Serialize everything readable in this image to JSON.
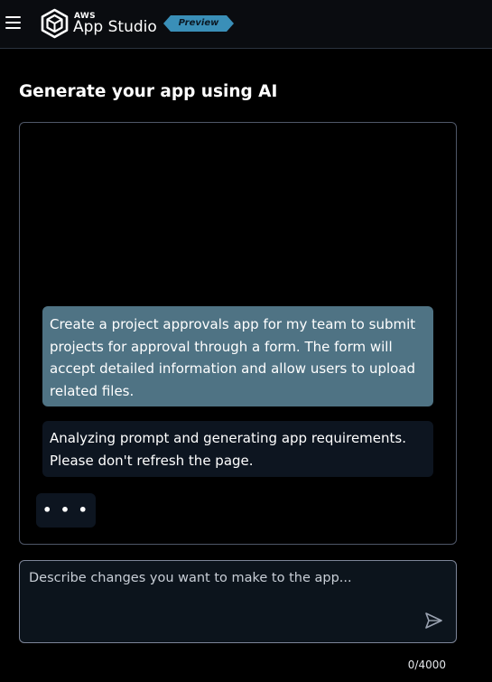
{
  "header": {
    "brand_small": "AWS",
    "brand_main": "App Studio",
    "badge": "Preview",
    "menu_icon": "hamburger-menu-icon",
    "logo_icon": "app-studio-cube-logo"
  },
  "page": {
    "title": "Generate your app using AI"
  },
  "chat": {
    "user_message": "Create a project approvals app for my team to submit projects for approval through a form. The form will accept detailed information and allow users to upload related files.",
    "status_message": "Analyzing prompt and generating app requirements. Please don't refresh the page.",
    "typing_indicator": "• • •"
  },
  "composer": {
    "placeholder": "Describe changes you want to make to the app...",
    "value": "",
    "char_count": "0/4000",
    "send_icon": "send-icon"
  },
  "colors": {
    "background": "#000000",
    "user_bubble": "#4f7384",
    "status_bubble": "#0d1520",
    "badge": "#3a8fb8",
    "border": "#4f5768"
  }
}
